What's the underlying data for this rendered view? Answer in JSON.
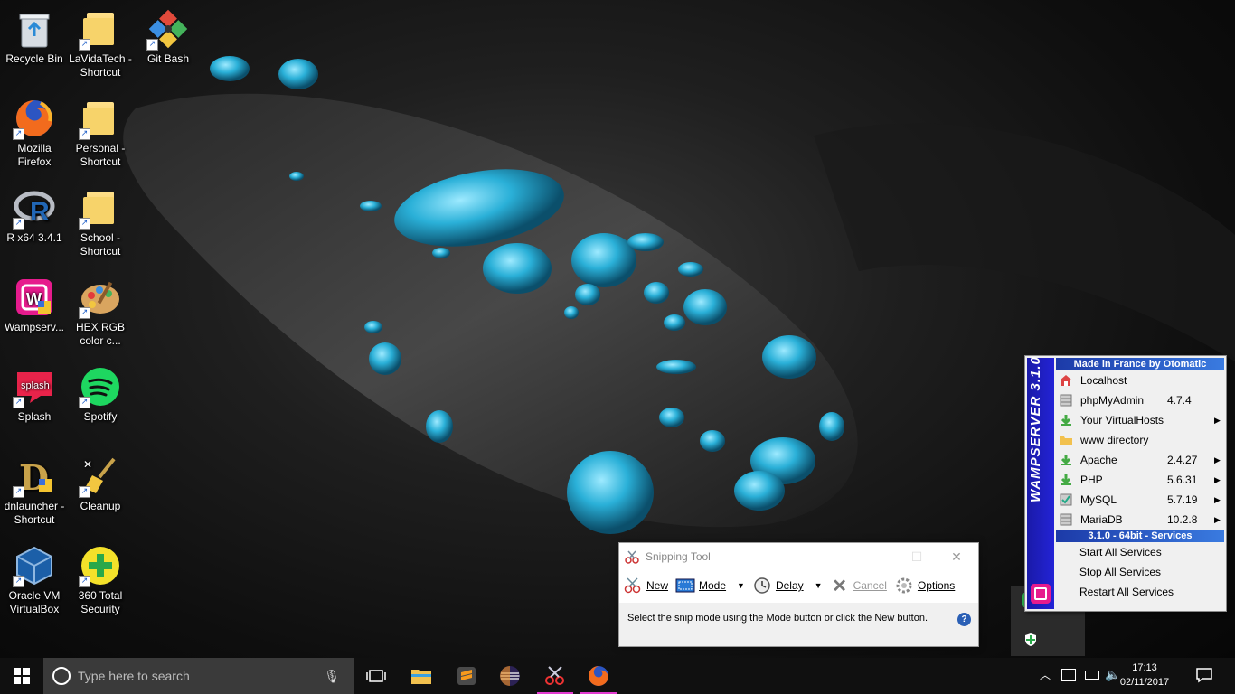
{
  "desktop": {
    "icons": [
      {
        "label": "Recycle Bin"
      },
      {
        "label": "LaVidaTech - Shortcut"
      },
      {
        "label": "Git Bash"
      },
      {
        "label": "Mozilla Firefox"
      },
      {
        "label": "Personal - Shortcut"
      },
      {
        "label": "R x64 3.4.1"
      },
      {
        "label": "School - Shortcut"
      },
      {
        "label": "Wampserv..."
      },
      {
        "label": "HEX RGB color c..."
      },
      {
        "label": "Splash"
      },
      {
        "label": "Spotify"
      },
      {
        "label": "dnlauncher - Shortcut"
      },
      {
        "label": "Cleanup"
      },
      {
        "label": "Oracle VM VirtualBox"
      },
      {
        "label": "360 Total Security"
      }
    ]
  },
  "wamp": {
    "side_title": "WAMPSERVER 3.1.0",
    "header1": "Made in France by Otomatic",
    "items": [
      {
        "label": "Localhost",
        "value": "",
        "arrow": ""
      },
      {
        "label": "phpMyAdmin",
        "value": "4.7.4",
        "arrow": ""
      },
      {
        "label": "Your VirtualHosts",
        "value": "",
        "arrow": "▶"
      },
      {
        "label": "www directory",
        "value": "",
        "arrow": ""
      },
      {
        "label": "Apache",
        "value": "2.4.27",
        "arrow": "▶"
      },
      {
        "label": "PHP",
        "value": "5.6.31",
        "arrow": "▶"
      },
      {
        "label": "MySQL",
        "value": "5.7.19",
        "arrow": "▶"
      },
      {
        "label": "MariaDB",
        "value": "10.2.8",
        "arrow": "▶"
      }
    ],
    "header2": "3.1.0 - 64bit - Services",
    "services": [
      "Start All Services",
      "Stop All Services",
      "Restart All Services"
    ]
  },
  "snipping_tool": {
    "title": "Snipping Tool",
    "new_label": "New",
    "mode_label": "Mode",
    "delay_label": "Delay",
    "cancel_label": "Cancel",
    "options_label": "Options",
    "message": "Select the snip mode using the Mode button or click the New button."
  },
  "taskbar": {
    "search_placeholder": "Type here to search",
    "time": "17:13",
    "date": "02/11/2017"
  }
}
